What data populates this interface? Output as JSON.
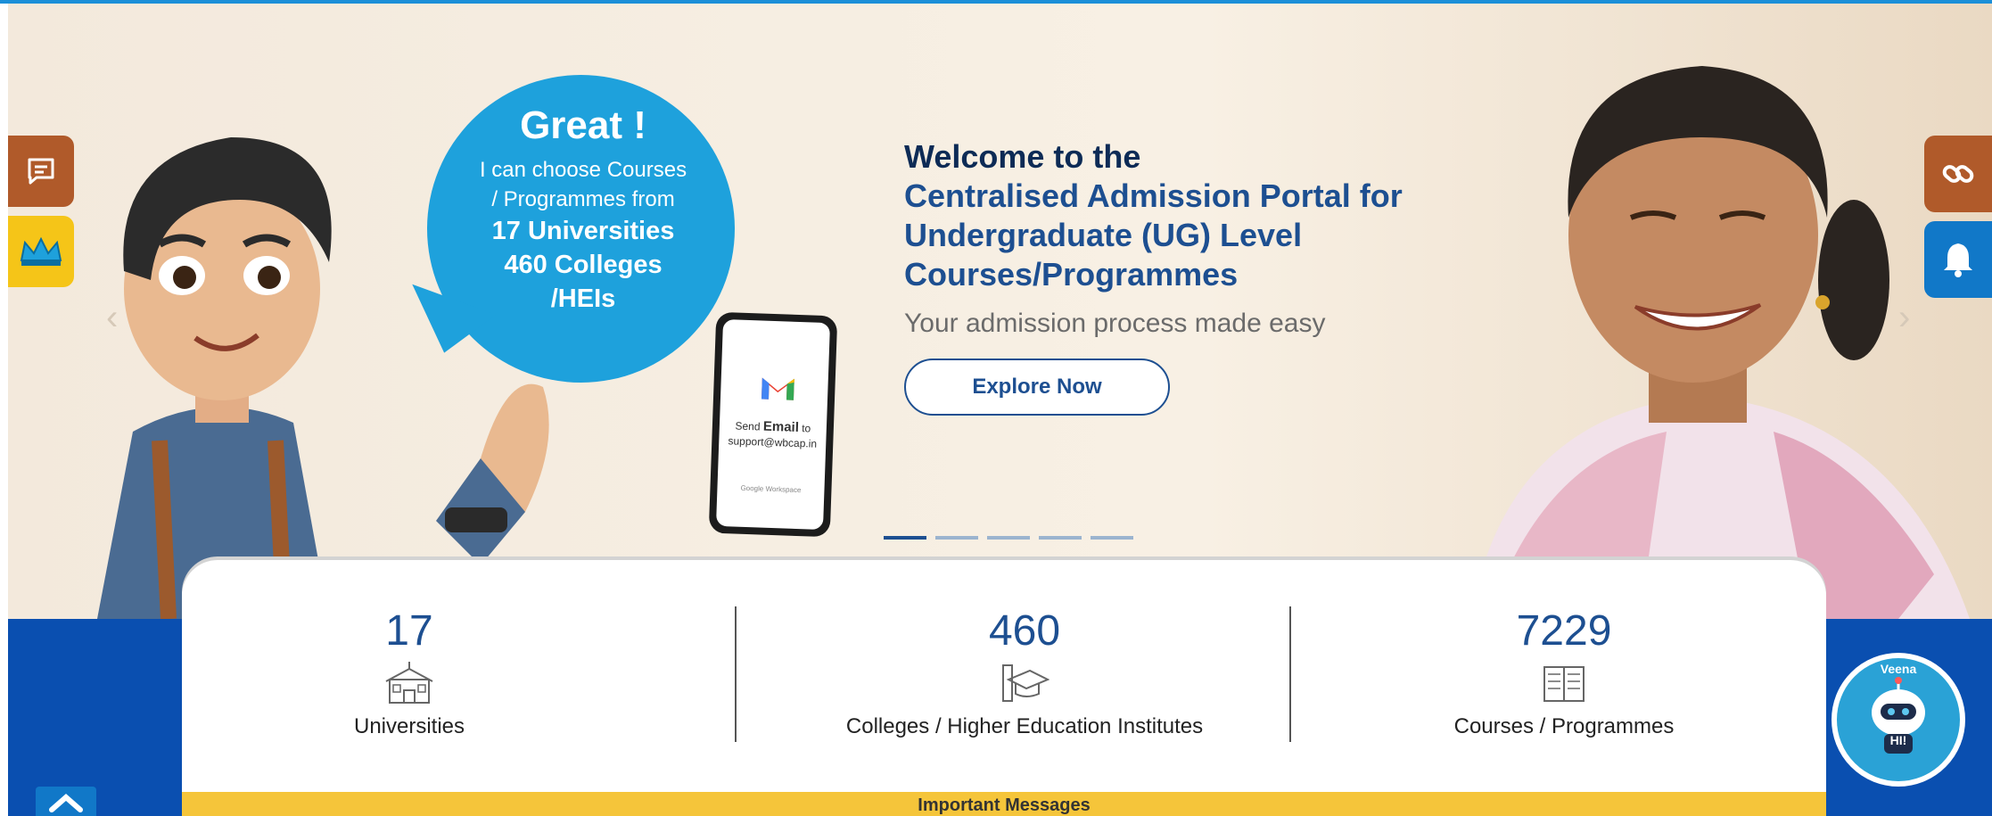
{
  "hero": {
    "welcome": "Welcome to the",
    "title_lines": [
      "Centralised Admission Portal for",
      "Undergraduate (UG) Level",
      "Courses/Programmes"
    ],
    "tagline": "Your admission process made easy",
    "cta_label": "Explore Now",
    "bubble": {
      "title": "Great !",
      "line1": "I can choose Courses",
      "line2": "/ Programmes from",
      "line3": "17 Universities",
      "line4": "460 Colleges",
      "line5": "/HEIs"
    },
    "phone": {
      "text_prefix": "Send",
      "text_strong": "Email",
      "text_suffix": "to",
      "email": "support@wbcap.in",
      "footer": "Google Workspace"
    },
    "slide_count": 5,
    "active_slide": 1
  },
  "stats": [
    {
      "value": "17",
      "label": "Universities",
      "icon": "university-icon"
    },
    {
      "value": "460",
      "label": "Colleges / Higher Education Institutes",
      "icon": "graduation-icon"
    },
    {
      "value": "7229",
      "label": "Courses / Programmes",
      "icon": "book-icon"
    }
  ],
  "messages": {
    "title": "Important Messages"
  },
  "chatbot": {
    "name": "Veena",
    "greeting": "HI!"
  },
  "colors": {
    "accent": "#1d4f91",
    "band": "#0a4fb0",
    "bubble": "#1ea1dc",
    "widget_brown": "#b05a2a",
    "widget_yellow": "#f5c518",
    "messages_bar": "#f5c53a"
  },
  "icons": {
    "left_widgets": [
      "chat-icon",
      "crown-icon"
    ],
    "right_widgets": [
      "link-icon",
      "bell-icon"
    ],
    "scroll_top": "chevron-up-icon"
  }
}
